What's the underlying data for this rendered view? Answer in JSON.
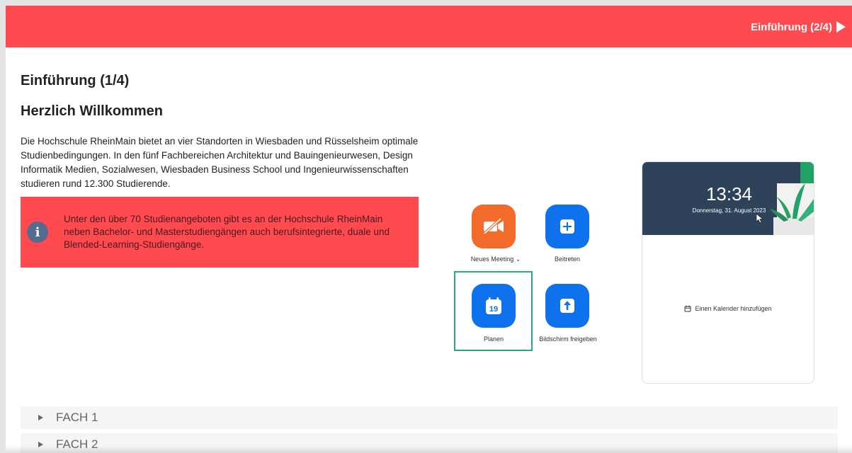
{
  "topbar": {
    "next_label": "Einführung (2/4)",
    "color": "#ff4b4f"
  },
  "content": {
    "title": "Einführung (1/4)",
    "subtitle": "Herzlich Willkommen",
    "intro": "Die Hochschule RheinMain bietet an vier Standorten in Wiesbaden und Rüsselsheim optimale Studienbedingungen. In den fünf Fachbereichen Architektur und Bauingenieurwesen, Design Informatik Medien, Sozialwesen, Wiesbaden Business School und Ingenieurwissenschaften studieren rund 12.300 Studierende.",
    "info_icon": "info-icon",
    "info_text": "Unter den über 70 Studienangeboten gibt es an der Hochschule RheinMain neben Bachelor- und Masterstudiengängen auch berufsintegrierte, duale und Blended-Learning-Studiengänge."
  },
  "zoom": {
    "new_meeting": "Neues Meeting",
    "join": "Beitreten",
    "schedule": "Planen",
    "share": "Bildschirm freigeben",
    "calendar_day": "19",
    "time": "13:34",
    "date": "Donnerstag, 31. August 2023",
    "add_calendar": "Einen Kalender hinzufügen",
    "orange": "#f26b2b",
    "blue": "#0e72ed",
    "highlight": "#2aa586"
  },
  "accordion": [
    {
      "label": "FACH 1"
    },
    {
      "label": "FACH 2"
    }
  ]
}
